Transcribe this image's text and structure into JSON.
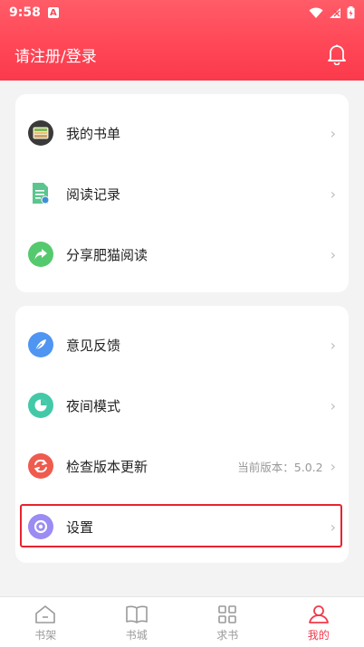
{
  "status_bar": {
    "time": "9:58",
    "notification_letter": "A"
  },
  "header": {
    "title": "请注册/登录"
  },
  "menu_group_1": [
    {
      "label": "我的书单",
      "icon": "wallet-icon"
    },
    {
      "label": "阅读记录",
      "icon": "document-icon"
    },
    {
      "label": "分享肥猫阅读",
      "icon": "share-icon"
    }
  ],
  "menu_group_2": [
    {
      "label": "意见反馈",
      "icon": "feather-icon"
    },
    {
      "label": "夜间模式",
      "icon": "moon-icon"
    },
    {
      "label": "检查版本更新",
      "icon": "refresh-icon",
      "meta": "当前版本：5.0.2"
    },
    {
      "label": "设置",
      "icon": "settings-icon"
    }
  ],
  "tabbar": [
    {
      "label": "书架",
      "icon": "home-icon"
    },
    {
      "label": "书城",
      "icon": "book-icon"
    },
    {
      "label": "求书",
      "icon": "grid-icon"
    },
    {
      "label": "我的",
      "icon": "user-icon",
      "active": true
    }
  ],
  "colors": {
    "brand": "#ff4757",
    "active_tab": "#f13a4a",
    "highlight": "#e8232e"
  }
}
